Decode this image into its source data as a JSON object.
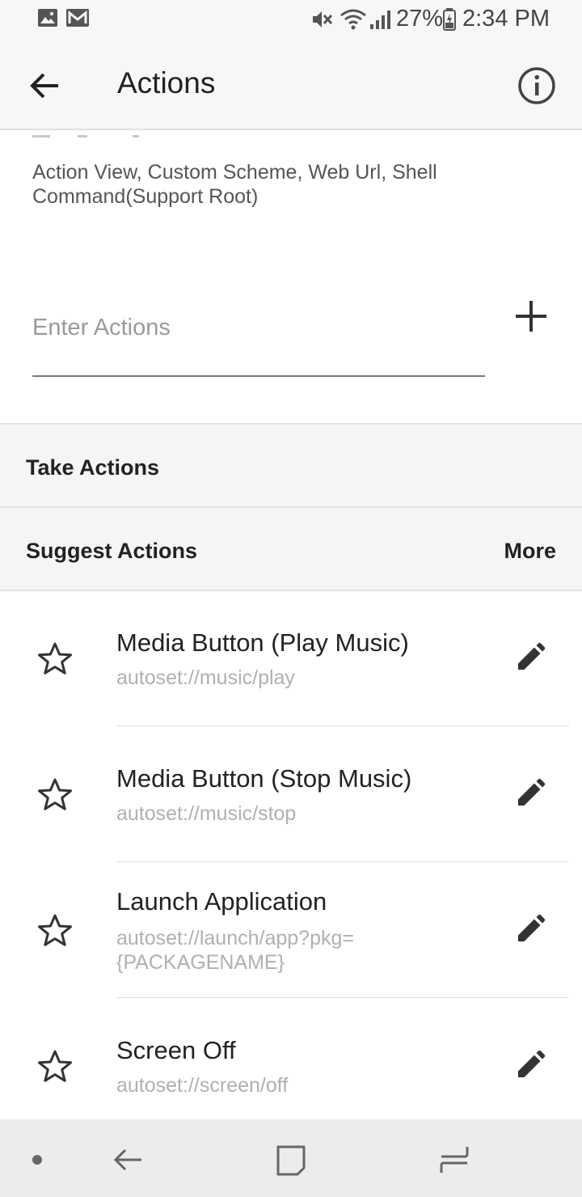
{
  "status_bar": {
    "battery": "27%",
    "time": "2:34 PM",
    "left_icons": [
      "gallery-icon",
      "gmail-icon"
    ],
    "right_icons": [
      "mute-icon",
      "wifi-icon",
      "signal-icon",
      "battery-icon"
    ]
  },
  "app_bar": {
    "title": "Actions",
    "back_icon": "arrow-left-icon",
    "info_icon": "info-icon"
  },
  "content": {
    "description": "Action View, Custom Scheme, Web Url, Shell Command(Support Root)",
    "input": {
      "placeholder": "Enter Actions",
      "value": ""
    },
    "add_icon": "plus-icon"
  },
  "sections": {
    "take_actions": "Take Actions",
    "suggest_actions": "Suggest Actions",
    "more": "More"
  },
  "suggestions": [
    {
      "title": "Media Button (Play Music)",
      "subtitle": "autoset://music/play"
    },
    {
      "title": "Media Button (Stop Music)",
      "subtitle": "autoset://music/stop"
    },
    {
      "title": "Launch Application",
      "subtitle": "autoset://launch/app?pkg={PACKAGENAME}"
    },
    {
      "title": "Screen Off",
      "subtitle": "autoset://screen/off"
    }
  ],
  "nav_bar": [
    "dot-icon",
    "back-icon",
    "recents-icon",
    "switch-icon"
  ],
  "colors": {
    "accent": "#222222",
    "subtitle": "#b0b0b0",
    "background": "#f5f5f5"
  }
}
